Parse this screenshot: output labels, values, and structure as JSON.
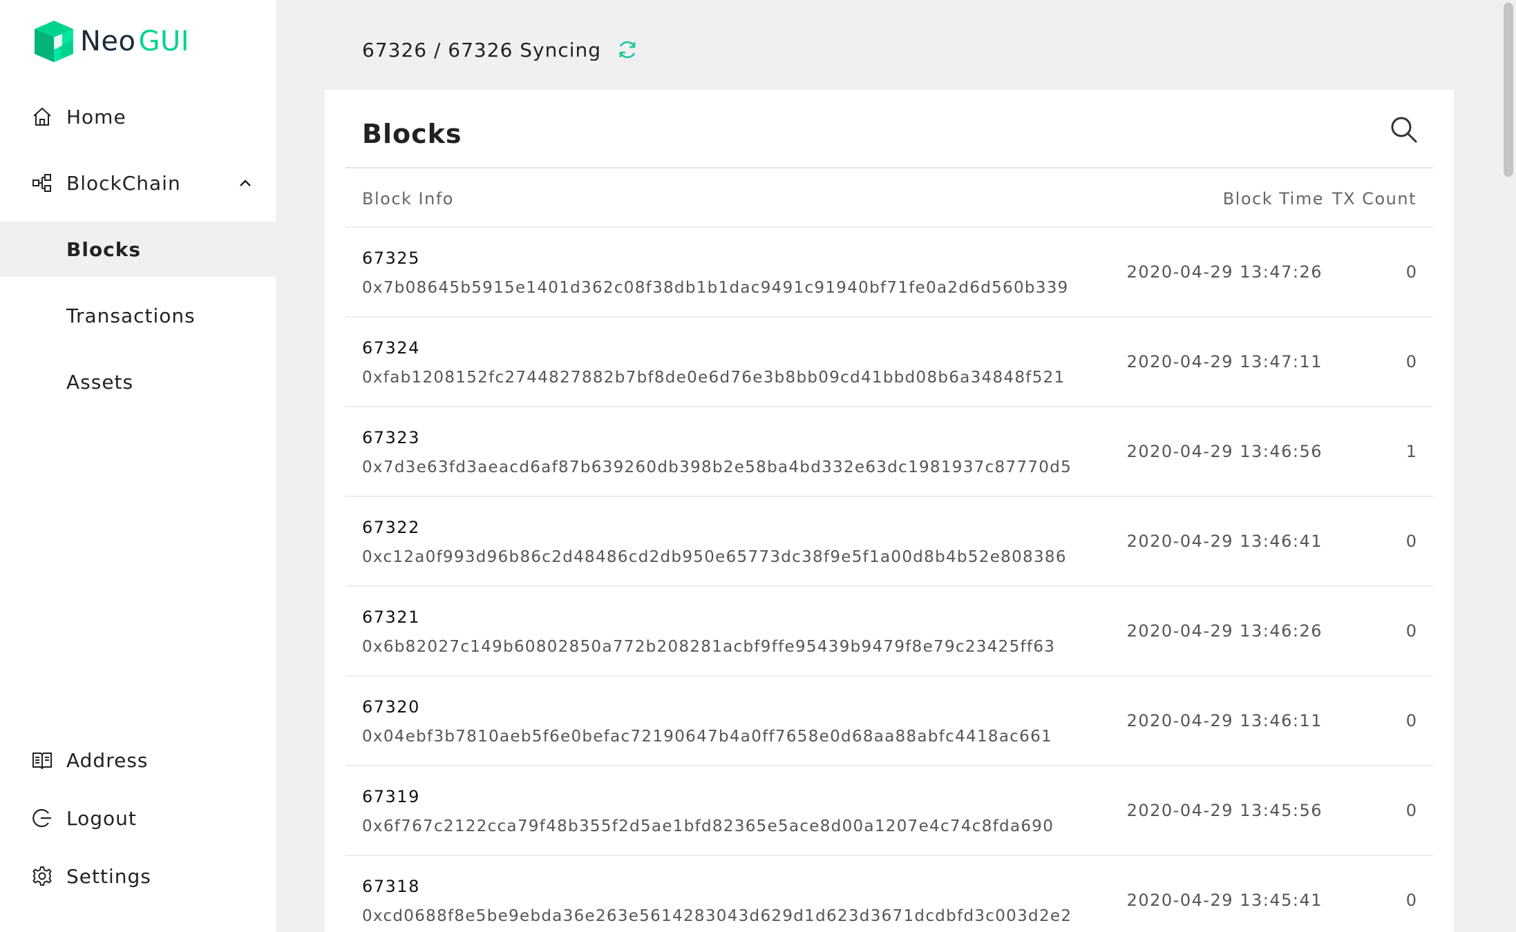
{
  "app": {
    "logo_neo": "Neo",
    "logo_gui": "GUI"
  },
  "colors": {
    "brand_green": "#00d38e",
    "brand_dark": "#1b2a3a",
    "sync_icon": "#1ec59c"
  },
  "sidebar": {
    "home": "Home",
    "blockchain": "BlockChain",
    "blocks": "Blocks",
    "transactions": "Transactions",
    "assets": "Assets",
    "address": "Address",
    "logout": "Logout",
    "settings": "Settings"
  },
  "header": {
    "sync_status": "67326 / 67326 Syncing"
  },
  "card": {
    "title": "Blocks",
    "columns": {
      "info": "Block Info",
      "time": "Block Time",
      "count": "TX Count"
    }
  },
  "blocks": [
    {
      "index": "67325",
      "hash": "0x7b08645b5915e1401d362c08f38db1b1dac9491c91940bf71fe0a2d6d560b339",
      "time": "2020-04-29 13:47:26",
      "tx": "0"
    },
    {
      "index": "67324",
      "hash": "0xfab1208152fc2744827882b7bf8de0e6d76e3b8bb09cd41bbd08b6a34848f521",
      "time": "2020-04-29 13:47:11",
      "tx": "0"
    },
    {
      "index": "67323",
      "hash": "0x7d3e63fd3aeacd6af87b639260db398b2e58ba4bd332e63dc1981937c87770d5",
      "time": "2020-04-29 13:46:56",
      "tx": "1"
    },
    {
      "index": "67322",
      "hash": "0xc12a0f993d96b86c2d48486cd2db950e65773dc38f9e5f1a00d8b4b52e808386",
      "time": "2020-04-29 13:46:41",
      "tx": "0"
    },
    {
      "index": "67321",
      "hash": "0x6b82027c149b60802850a772b208281acbf9ffe95439b9479f8e79c23425ff63",
      "time": "2020-04-29 13:46:26",
      "tx": "0"
    },
    {
      "index": "67320",
      "hash": "0x04ebf3b7810aeb5f6e0befac72190647b4a0ff7658e0d68aa88abfc4418ac661",
      "time": "2020-04-29 13:46:11",
      "tx": "0"
    },
    {
      "index": "67319",
      "hash": "0x6f767c2122cca79f48b355f2d5ae1bfd82365e5ace8d00a1207e4c74c8fda690",
      "time": "2020-04-29 13:45:56",
      "tx": "0"
    },
    {
      "index": "67318",
      "hash": "0xcd0688f8e5be9ebda36e263e5614283043d629d1d623d3671dcdbfd3c003d2e2",
      "time": "2020-04-29 13:45:41",
      "tx": "0"
    }
  ]
}
